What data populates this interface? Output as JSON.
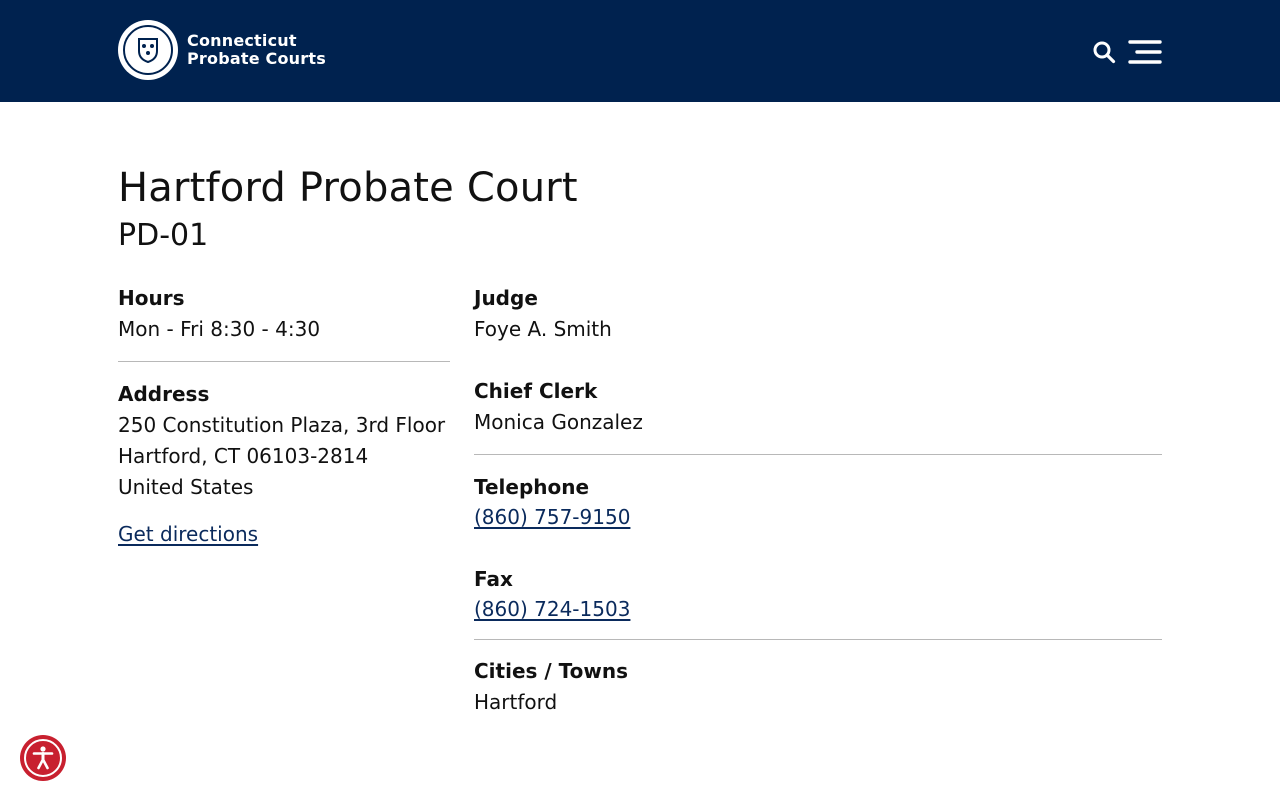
{
  "header": {
    "logo_line1": "Connecticut",
    "logo_line2": "Probate Courts",
    "search_icon": "search-icon",
    "menu_icon": "hamburger-menu-icon",
    "background_color": "#00224f"
  },
  "court": {
    "title": "Hartford Probate Court",
    "code": "PD-01"
  },
  "details": {
    "hours_label": "Hours",
    "hours_value": "Mon - Fri 8:30 - 4:30",
    "address_label": "Address",
    "address_line1": "250 Constitution Plaza, 3rd Floor",
    "address_line2": "Hartford, CT 06103-2814",
    "address_line3": "United States",
    "directions_link": "Get directions",
    "judge_label": "Judge",
    "judge_value": "Foye A. Smith",
    "clerk_label": "Chief Clerk",
    "clerk_value": "Monica Gonzalez",
    "telephone_label": "Telephone",
    "telephone_value": "(860) 757-9150",
    "fax_label": "Fax",
    "fax_value": "(860) 724-1503",
    "towns_label": "Cities / Towns",
    "towns_value": "Hartford"
  },
  "accessibility": {
    "icon": "accessibility-icon",
    "color": "#c8202f"
  },
  "colors": {
    "link": "#0a2a5c",
    "text": "#111111",
    "divider": "#b8b8b8"
  }
}
